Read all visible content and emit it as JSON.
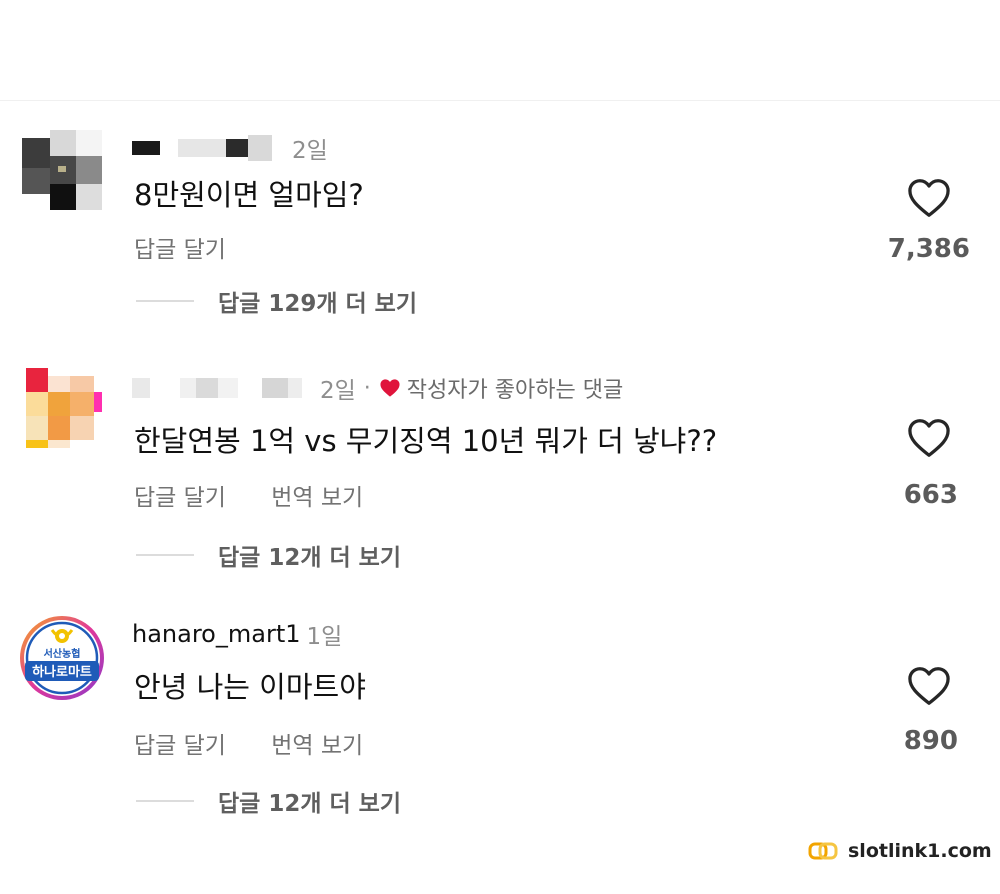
{
  "colors": {
    "heart_outline": "#262626",
    "creator_heart": "#e0143c",
    "muted_text": "#8e8e8e",
    "action_text": "#737373",
    "reply_line": "#dcdcdc",
    "hanaro_blue": "#1f5bb8",
    "hanaro_gold": "#f2c200",
    "hanaro_pink": "#e0389a"
  },
  "comments": [
    {
      "time": "2일",
      "text": "8만원이면 얼마임?",
      "reply_action": "답글 달기",
      "likes": "7,386",
      "view_replies": "답글 129개 더 보기",
      "avatar": "pixelated-avatar",
      "username_display": "redacted"
    },
    {
      "time": "2일",
      "separator": "·",
      "creator_liked": "작성자가 좋아하는 댓글",
      "text": "한달연봉 1억 vs 무기징역 10년 뭐가 더 낳냐??",
      "reply_action": "답글 달기",
      "translate_action": "번역 보기",
      "likes": "663",
      "view_replies": "답글 12개 더 보기",
      "avatar": "pixelated-avatar",
      "username_display": "redacted"
    },
    {
      "username": "hanaro_mart1",
      "time": "1일",
      "text": "안녕 나는 이마트야",
      "reply_action": "답글 달기",
      "translate_action": "번역 보기",
      "likes": "890",
      "view_replies": "답글 12개 더 보기",
      "avatar": "hanaro-mart-logo",
      "avatar_text_top": "서산농협",
      "avatar_text_main": "하나로마트"
    }
  ],
  "watermark": {
    "text": "slotlink1.com",
    "icon": "link-icon"
  }
}
